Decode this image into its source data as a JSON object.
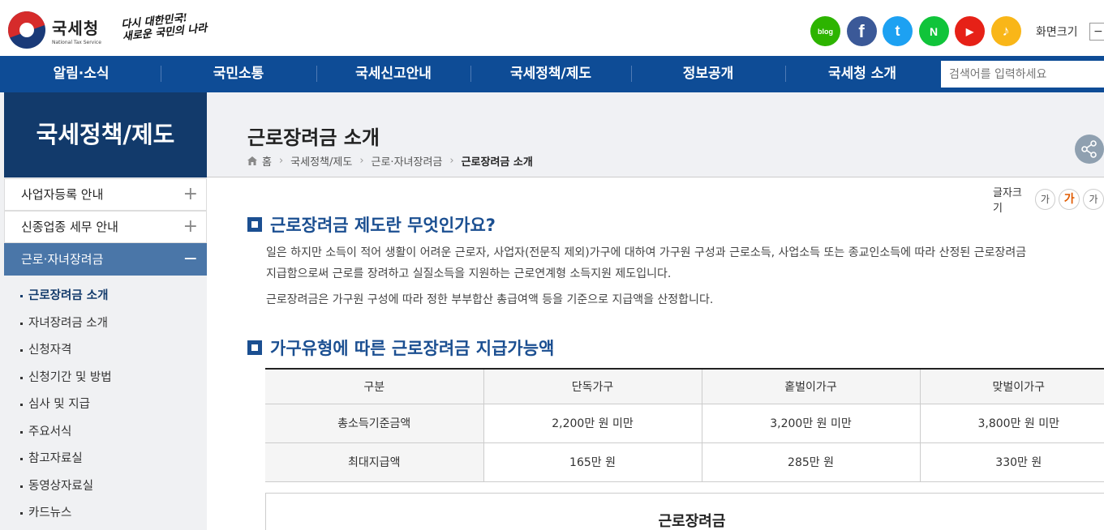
{
  "header": {
    "logo_name": "국세청",
    "logo_sub": "National Tax Service",
    "slogan_line1": "다시 대한민국!",
    "slogan_line2": "새로운 국민의 나라",
    "screen_size_label": "화면크기",
    "screen_size_btn": "−",
    "sns": [
      "blog",
      "f",
      "t",
      "N",
      "▶",
      "♪"
    ]
  },
  "nav": {
    "items": [
      "알림·소식",
      "국민소통",
      "국세신고안내",
      "국세정책/제도",
      "정보공개",
      "국세청 소개"
    ],
    "search_placeholder": "검색어를 입력하세요"
  },
  "sidebar": {
    "title": "국세정책/제도",
    "items": [
      {
        "label": "사업자등록 안내",
        "sign": "+"
      },
      {
        "label": "신종업종 세무 안내",
        "sign": "+"
      },
      {
        "label": "근로·자녀장려금",
        "sign": "−"
      }
    ],
    "subitems": [
      "근로장려금 소개",
      "자녀장려금 소개",
      "신청자격",
      "신청기간 및 방법",
      "심사 및 지급",
      "주요서식",
      "참고자료실",
      "동영상자료실",
      "카드뉴스"
    ]
  },
  "content": {
    "page_title": "근로장려금 소개",
    "breadcrumb": [
      "홈",
      "국세정책/제도",
      "근로·자녀장려금",
      "근로장려금 소개"
    ],
    "fontsize_label": "글자크기",
    "fontsize_small": "가",
    "fontsize_big": "가",
    "fontsize_more": "가",
    "section1_title": "근로장려금 제도란 무엇인가요?",
    "section1_p1_line1": "일은 하지만 소득이 적어 생활이 어려운 근로자, 사업자(전문직 제외)가구에 대하여 가구원 구성과 근로소득, 사업소득 또는 종교인소득에 따라 산정된 근로장려금",
    "section1_p1_line2": "지급함으로써 근로를 장려하고 실질소득을 지원하는 근로연계형 소득지원 제도입니다.",
    "section1_p2": "근로장려금은 가구원 구성에 따라 정한 부부합산 총급여액 등을 기준으로 지급액을 산정합니다.",
    "section2_title": "가구유형에 따른 근로장려금 지급가능액",
    "table": {
      "headers": [
        "구분",
        "단독가구",
        "홑벌이가구",
        "맞벌이가구"
      ],
      "rows": [
        [
          "총소득기준금액",
          "2,200만 원 미만",
          "3,200만 원 미만",
          "3,800만 원 미만"
        ],
        [
          "최대지급액",
          "165만 원",
          "285만 원",
          "330만 원"
        ]
      ]
    },
    "box_title": "근로장려금"
  }
}
